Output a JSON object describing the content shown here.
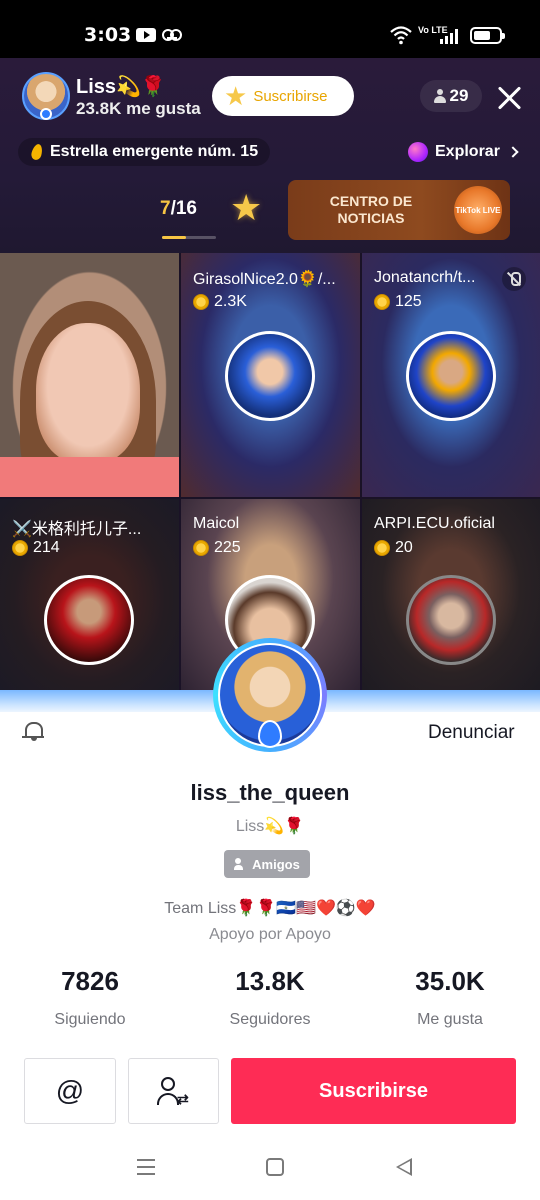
{
  "status_bar": {
    "time": "3:03",
    "network_label": "Vo LTE"
  },
  "live_header": {
    "host_name": "Liss💫🌹",
    "host_likes": "23.8K me gusta",
    "subscribe_label": "Suscribirse",
    "viewer_count": "29",
    "rank_text": "Estrella emergente núm. 15",
    "explore_label": "Explorar",
    "page_current": "7",
    "page_total": "/16",
    "page_progress": 0.44,
    "news_banner": "CENTRO DE NOTICIAS",
    "news_logo": "TikTok LIVE"
  },
  "guests": [
    {
      "name": "GirasolNice2.0🌻/...",
      "coins": "2.3K"
    },
    {
      "name": "Jonatancrh/t...",
      "coins": "125",
      "muted": true
    },
    {
      "name": "⚔️米格利托儿子...",
      "coins": "214"
    },
    {
      "name": "Maicol",
      "coins": "225"
    },
    {
      "name": "ARPI.ECU.oficial",
      "coins": "20"
    }
  ],
  "profile": {
    "report_label": "Denunciar",
    "username": "liss_the_queen",
    "nickname": "Liss💫🌹",
    "friends_badge": "Amigos",
    "bio_line1": "Team Liss🌹🌹🇸🇻🇺🇸❤️⚽❤️",
    "bio_line2": "Apoyo por Apoyo",
    "stats": [
      {
        "value": "7826",
        "label": "Siguiendo"
      },
      {
        "value": "13.8K",
        "label": "Seguidores"
      },
      {
        "value": "35.0K",
        "label": "Me gusta"
      }
    ],
    "mention_label": "@",
    "subscribe_label": "Suscribirse"
  },
  "colors": {
    "accent_red": "#fe2c55",
    "star_gold": "#f6c84a",
    "header_bg": "#241a38"
  },
  "icons": [
    "youtube-icon",
    "voicemail-icon",
    "wifi-icon",
    "signal-icon",
    "battery-icon",
    "person-icon",
    "close-icon",
    "flame-icon",
    "explore-orb-icon",
    "chevron-right-icon",
    "star-icon",
    "coin-icon",
    "mic-off-icon",
    "bell-icon",
    "friend-switch-icon",
    "nav-menu-icon",
    "nav-home-icon",
    "nav-back-icon"
  ]
}
